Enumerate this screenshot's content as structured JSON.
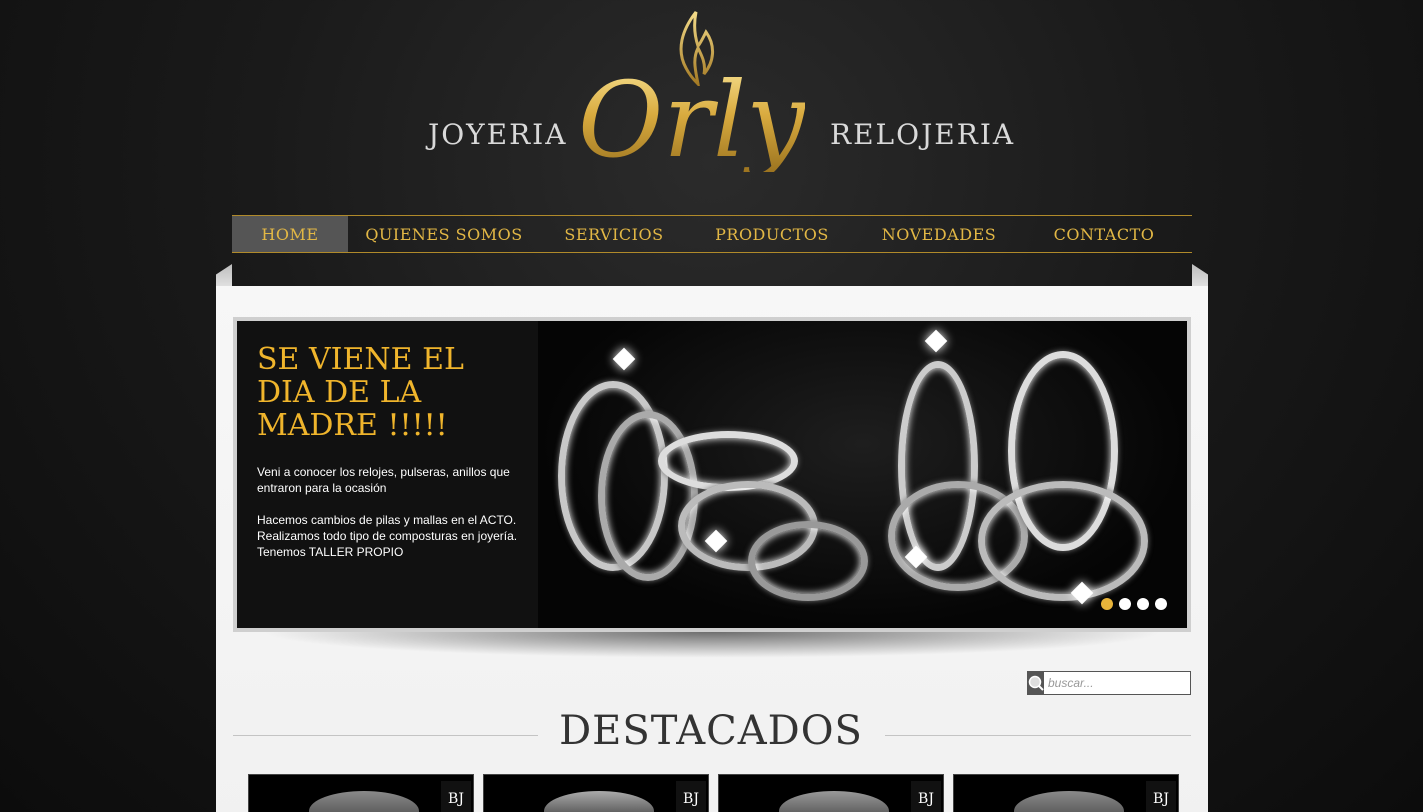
{
  "header": {
    "logo_left": "JOYERIA",
    "logo_main": "Orly",
    "logo_right": "RELOJERIA"
  },
  "nav": {
    "items": [
      {
        "label": "HOME",
        "active": true
      },
      {
        "label": "QUIENES SOMOS",
        "active": false
      },
      {
        "label": "SERVICIOS",
        "active": false
      },
      {
        "label": "PRODUCTOS",
        "active": false
      },
      {
        "label": "NOVEDADES",
        "active": false
      },
      {
        "label": "CONTACTO",
        "active": false
      }
    ]
  },
  "slider": {
    "title": "SE VIENE EL DIA DE LA MADRE !!!!!",
    "body": "Veni a conocer los relojes, pulseras, anillos que entraron para la ocasión\n\nHacemos cambios de pilas y mallas en el ACTO.\nRealizamos todo tipo de composturas en joyería. Tenemos TALLER PROPIO",
    "dots": 4,
    "active_dot": 1
  },
  "search": {
    "placeholder": "buscar..."
  },
  "featured": {
    "title": "DESTACADOS",
    "cards": [
      {
        "badge": "BJ"
      },
      {
        "badge": "BJ"
      },
      {
        "badge": "BJ"
      },
      {
        "badge": "BJ"
      }
    ]
  },
  "colors": {
    "gold": "#e2b745",
    "nav_active_bg": "#555555",
    "slide_title": "#f0b52c",
    "dot_active": "#e8b43a"
  }
}
